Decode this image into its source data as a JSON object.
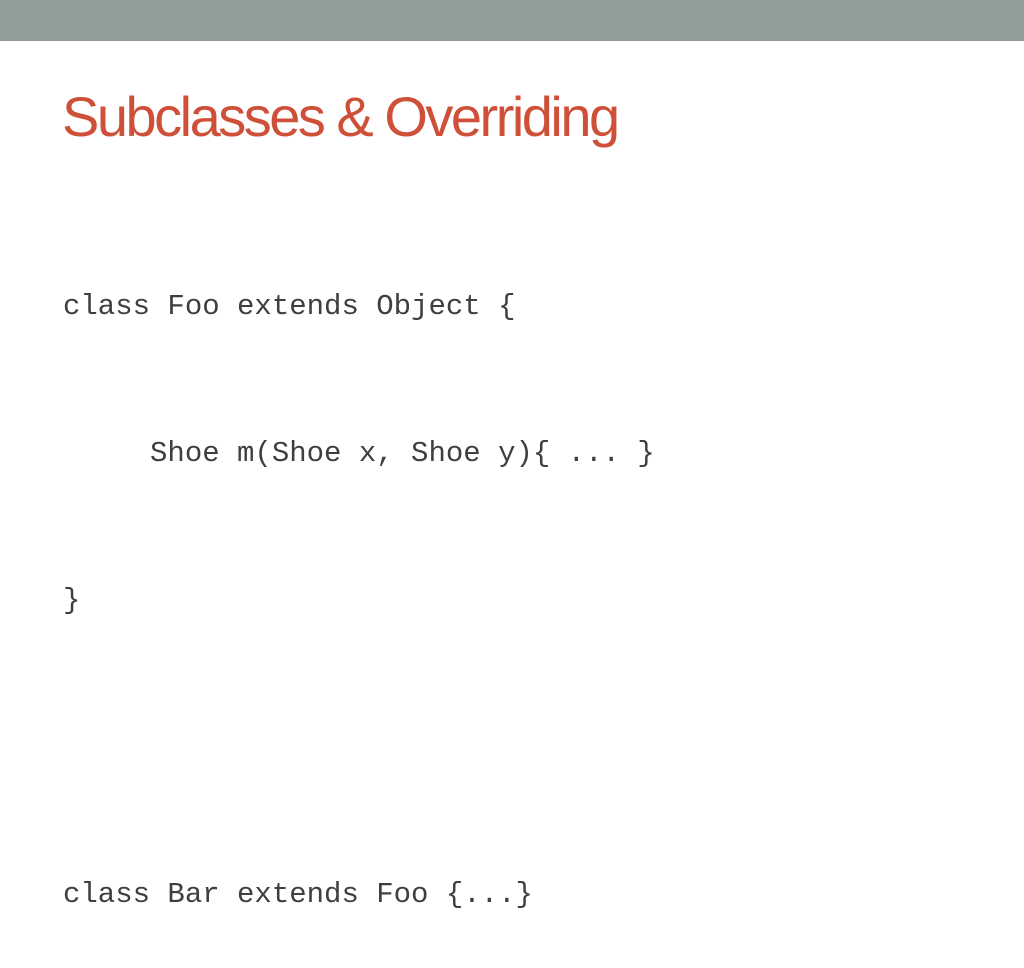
{
  "slide": {
    "title": "Subclasses & Overriding",
    "code_lines": [
      "class Foo extends Object {",
      "     Shoe m(Shoe x, Shoe y){ ... }",
      "}",
      "",
      "class Bar extends Foo {...}"
    ]
  },
  "colors": {
    "top_bar": "#919e97",
    "title": "#cf5039",
    "code_text": "#3f3f3f"
  }
}
